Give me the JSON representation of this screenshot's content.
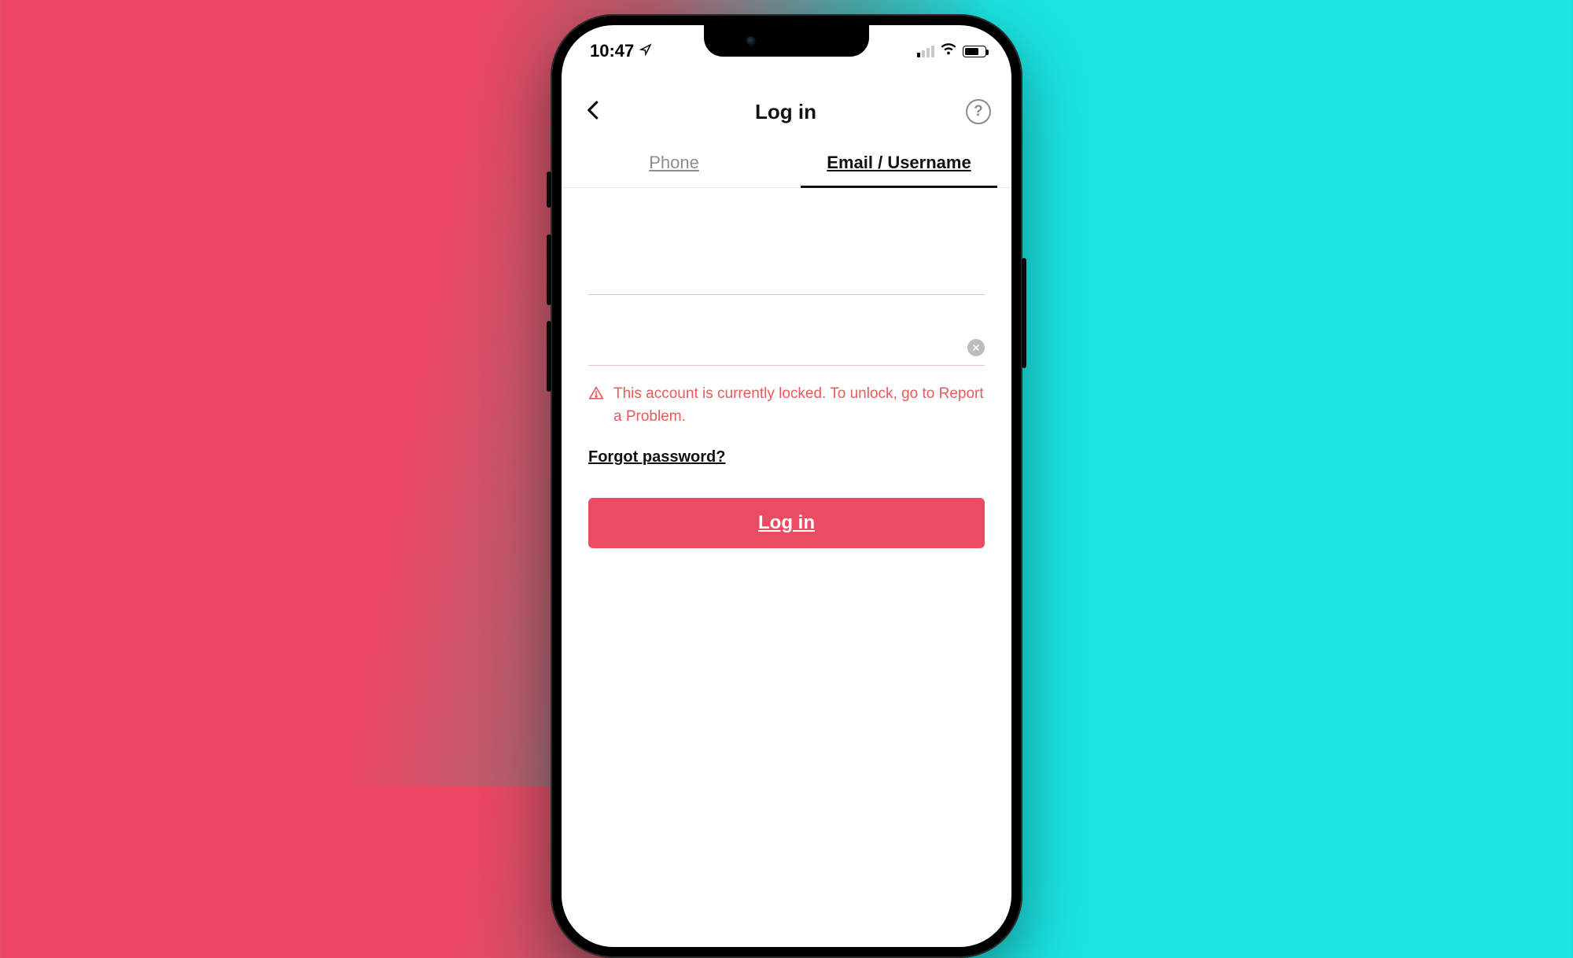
{
  "status": {
    "time": "10:47"
  },
  "nav": {
    "title": "Log in"
  },
  "tabs": {
    "phone": "Phone",
    "email": "Email / Username"
  },
  "error": {
    "message": "This account is currently locked. To unlock, go to Report a Problem."
  },
  "links": {
    "forgot": "Forgot password?"
  },
  "buttons": {
    "login": "Log in"
  }
}
